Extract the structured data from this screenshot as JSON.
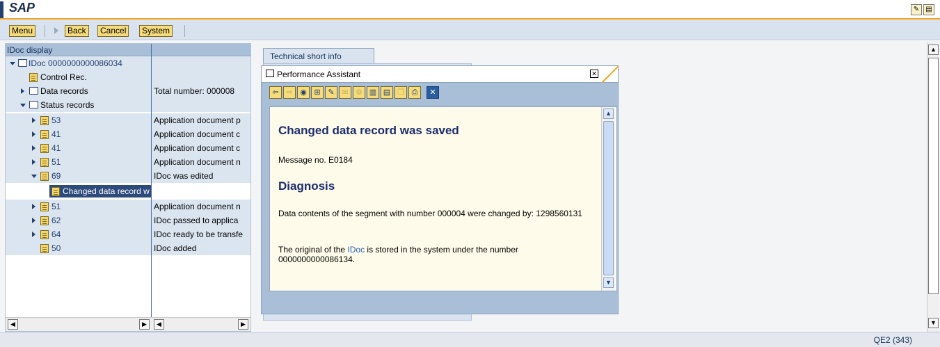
{
  "app": {
    "title": "SAP"
  },
  "menubar": {
    "menu": "Menu",
    "back": "Back",
    "cancel": "Cancel",
    "system": "System"
  },
  "tree": {
    "header": "IDoc display",
    "rows": [
      {
        "label": "IDoc 0000000000086034",
        "value": ""
      },
      {
        "label": "Control Rec.",
        "value": ""
      },
      {
        "label": "Data records",
        "value": "Total number: 000008"
      },
      {
        "label": "Status records",
        "value": ""
      },
      {
        "label": "53",
        "value": "Application document p"
      },
      {
        "label": "41",
        "value": "Application document c"
      },
      {
        "label": "41",
        "value": "Application document c"
      },
      {
        "label": "51",
        "value": "Application document n"
      },
      {
        "label": "69",
        "value": "IDoc was edited"
      },
      {
        "label": "Changed data record w",
        "value": ""
      },
      {
        "label": "51",
        "value": "Application document n"
      },
      {
        "label": "62",
        "value": "IDoc passed to applica"
      },
      {
        "label": "64",
        "value": "IDoc ready to be transfe"
      },
      {
        "label": "50",
        "value": "IDoc added"
      }
    ]
  },
  "tab": {
    "label": "Technical short info"
  },
  "dialog": {
    "title": "Performance Assistant",
    "heading": "Changed data record was saved",
    "message": "Message no. E0184",
    "diagnosis": "Diagnosis",
    "para1": "Data contents of the segment with number 000004 were changed by: 1298560131",
    "para2_pre": "The original of the ",
    "para2_link": "IDoc",
    "para2_post": " is stored in the system under the number 0000000000086134."
  },
  "status": {
    "system": "QE2 (343)"
  },
  "icons": {
    "toolbar": [
      "back-arrow-icon",
      "forward-arrow-icon",
      "technical-info-icon",
      "tree-structure-icon",
      "edit-icon",
      "help-icon",
      "settings-icon",
      "layout-icon",
      "export-icon",
      "copy-icon",
      "print-icon",
      "close-blue-icon"
    ]
  }
}
